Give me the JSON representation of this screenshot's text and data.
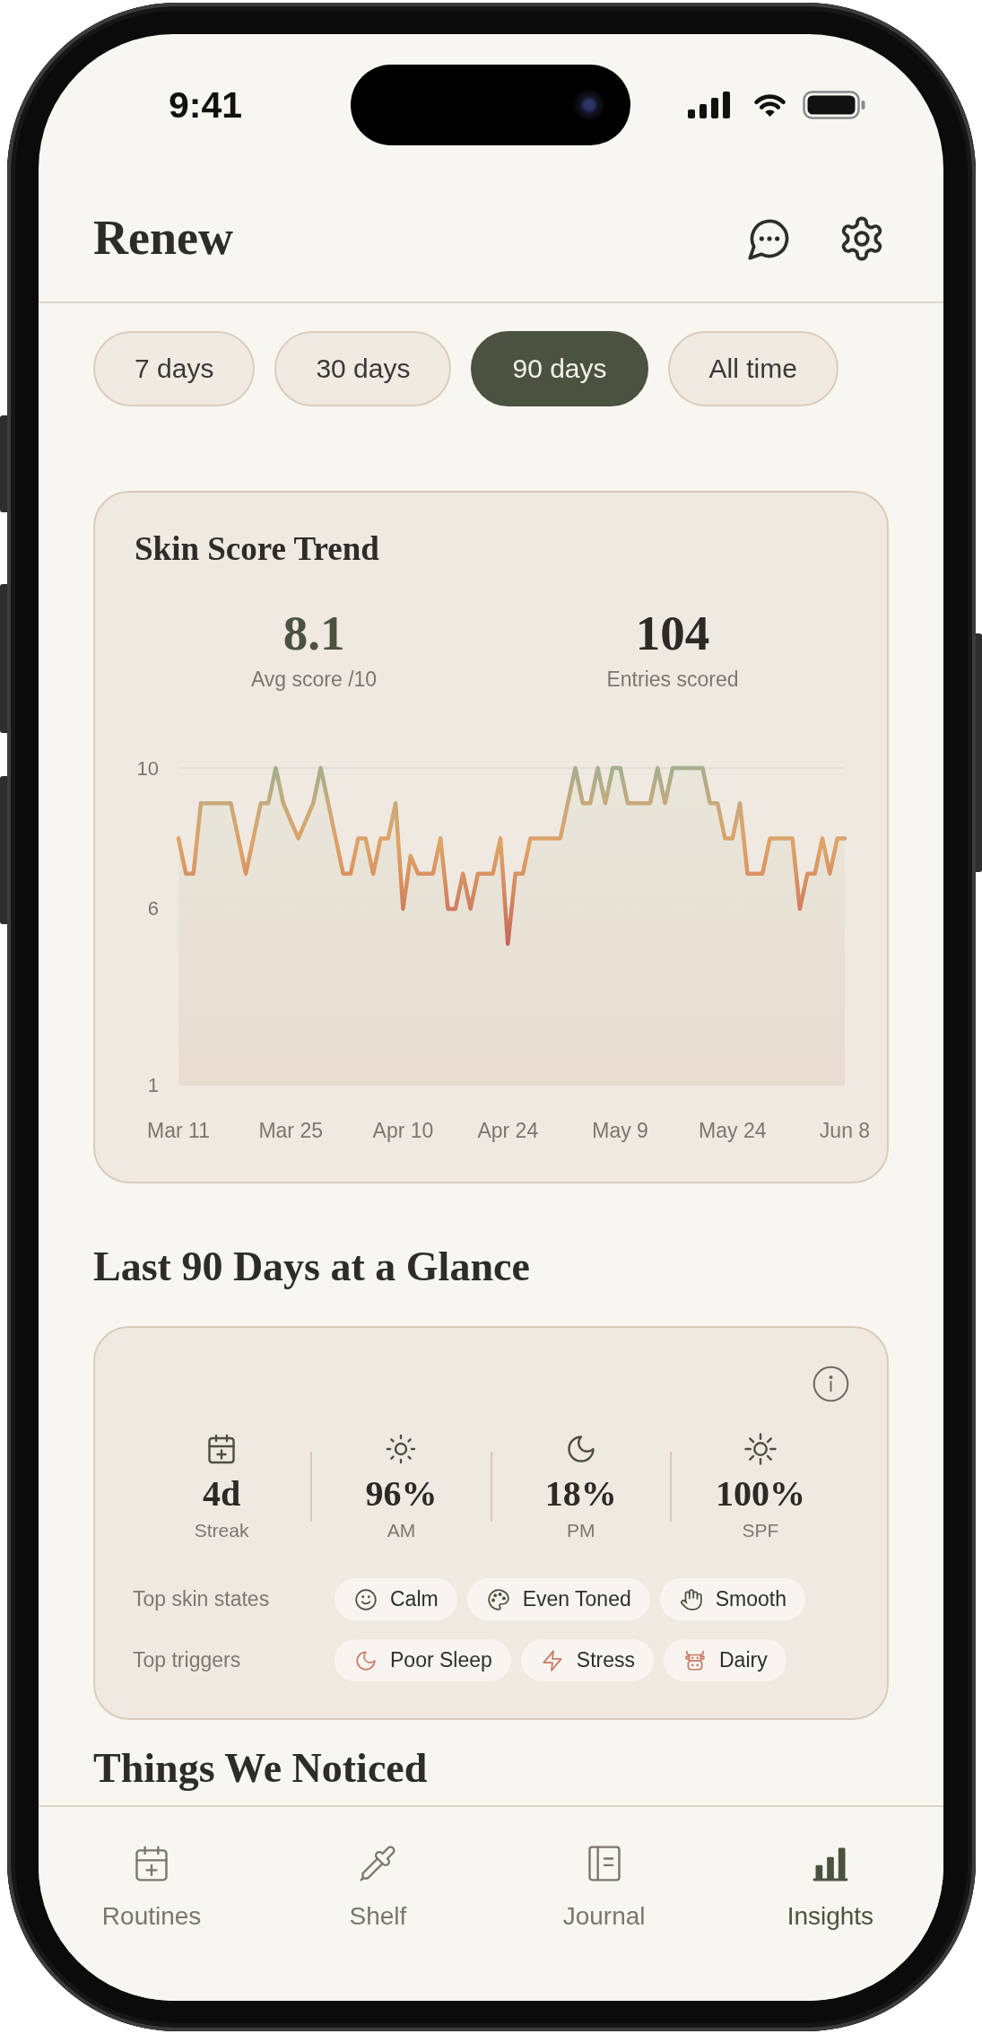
{
  "status_bar": {
    "time": "9:41"
  },
  "header": {
    "title": "Renew"
  },
  "tabs": [
    {
      "label": "7 days",
      "selected": false
    },
    {
      "label": "30 days",
      "selected": false
    },
    {
      "label": "90 days",
      "selected": true
    },
    {
      "label": "All time",
      "selected": false
    }
  ],
  "trend_card": {
    "title": "Skin Score Trend",
    "stats": [
      {
        "value": "8.1",
        "label": "Avg score /10",
        "kind": "accent"
      },
      {
        "value": "104",
        "label": "Entries scored",
        "kind": "plain"
      }
    ],
    "chart_data": {
      "type": "area",
      "categories": [
        "Mar 11",
        null,
        null,
        null,
        null,
        null,
        null,
        null,
        null,
        null,
        null,
        null,
        null,
        null,
        null,
        "Mar 25",
        null,
        null,
        null,
        null,
        null,
        null,
        null,
        null,
        null,
        null,
        null,
        null,
        null,
        null,
        "Apr 10",
        null,
        null,
        null,
        null,
        null,
        null,
        null,
        null,
        null,
        null,
        null,
        null,
        null,
        "Apr 24",
        null,
        null,
        null,
        null,
        null,
        null,
        null,
        null,
        null,
        null,
        null,
        null,
        null,
        null,
        "May 9",
        null,
        null,
        null,
        null,
        null,
        null,
        null,
        null,
        null,
        null,
        null,
        null,
        null,
        null,
        "May 24",
        null,
        null,
        null,
        null,
        null,
        null,
        null,
        null,
        null,
        null,
        null,
        null,
        null,
        null,
        "Jun 8"
      ],
      "ylim": [
        1,
        10
      ],
      "yticks": [
        1,
        6,
        10
      ],
      "values": [
        8,
        7,
        7,
        9,
        9,
        9,
        9,
        9,
        8,
        7,
        8,
        9,
        9,
        10,
        9,
        8.5,
        8,
        8.5,
        9,
        10,
        9,
        8,
        7,
        7,
        8,
        8,
        7,
        8,
        8,
        9,
        6,
        7.5,
        7,
        7,
        7,
        8,
        6,
        6,
        7,
        6,
        7,
        7,
        7,
        8,
        5,
        7,
        7,
        8,
        8,
        8,
        8,
        8,
        9,
        10,
        9,
        9,
        10,
        9,
        10,
        10,
        9,
        9,
        9,
        9,
        10,
        9,
        10,
        10,
        10,
        10,
        10,
        9,
        9,
        8,
        8,
        9,
        7,
        7,
        7,
        8,
        8,
        8,
        8,
        6,
        7,
        7,
        8,
        7,
        8,
        8
      ]
    }
  },
  "glance": {
    "heading": "Last 90 Days at a Glance",
    "stats": [
      {
        "value": "4d",
        "label": "Streak"
      },
      {
        "value": "96%",
        "label": "AM"
      },
      {
        "value": "18%",
        "label": "PM"
      },
      {
        "value": "100%",
        "label": "SPF"
      }
    ],
    "rows": [
      {
        "label": "Top skin states",
        "kind": "positive",
        "tags": [
          "Calm",
          "Even Toned",
          "Smooth"
        ]
      },
      {
        "label": "Top triggers",
        "kind": "negative",
        "tags": [
          "Poor Sleep",
          "Stress",
          "Dairy"
        ]
      }
    ]
  },
  "next_section": {
    "heading": "Things We Noticed"
  },
  "nav": [
    {
      "label": "Routines",
      "selected": false
    },
    {
      "label": "Shelf",
      "selected": false
    },
    {
      "label": "Journal",
      "selected": false
    },
    {
      "label": "Insights",
      "selected": true
    }
  ]
}
